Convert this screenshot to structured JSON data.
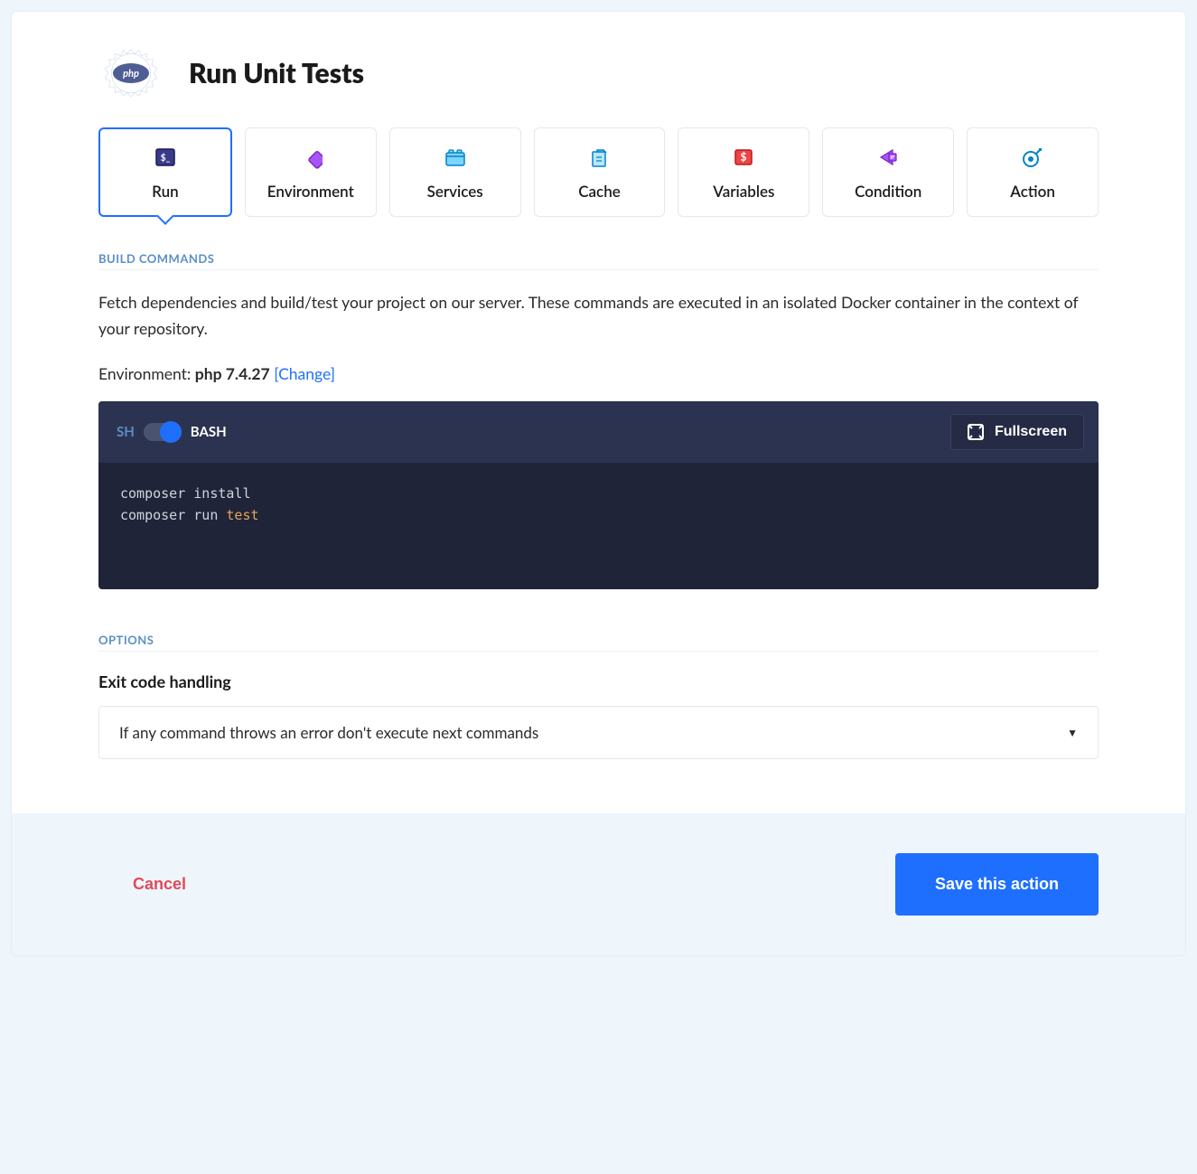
{
  "header": {
    "title": "Run Unit Tests",
    "badge": "php"
  },
  "tabs": [
    {
      "label": "Run"
    },
    {
      "label": "Environment"
    },
    {
      "label": "Services"
    },
    {
      "label": "Cache"
    },
    {
      "label": "Variables"
    },
    {
      "label": "Condition"
    },
    {
      "label": "Action"
    }
  ],
  "build": {
    "section_title": "BUILD COMMANDS",
    "description": "Fetch dependencies and build/test your project on our server. These commands are executed in an isolated Docker container in the context of your repository.",
    "env_label": "Environment: ",
    "env_value": "php 7.4.27",
    "change_label": "[Change]",
    "shell_sh": "SH",
    "shell_bash": "BASH",
    "fullscreen": "Fullscreen",
    "code_line1_a": "composer install",
    "code_line2_a": "composer run ",
    "code_line2_b": "test"
  },
  "options": {
    "section_title": "OPTIONS",
    "label": "Exit code handling",
    "selected": "If any command throws an error don't execute next commands"
  },
  "footer": {
    "cancel": "Cancel",
    "save": "Save this action"
  }
}
